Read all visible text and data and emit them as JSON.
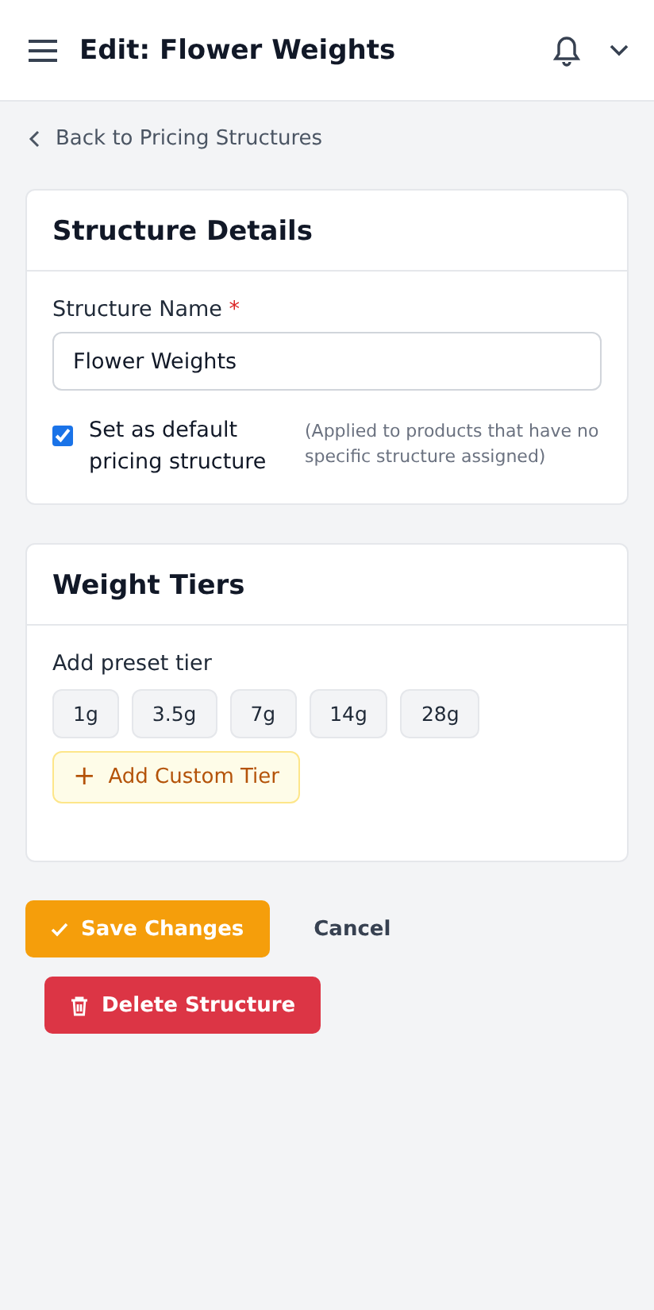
{
  "header": {
    "title": "Edit: Flower Weights"
  },
  "back_link": {
    "label": "Back to Pricing Structures"
  },
  "structure_details": {
    "title": "Structure Details",
    "name_label": "Structure Name",
    "required_mark": "*",
    "name_value": "Flower Weights",
    "default_option": {
      "label": "Set as default pricing structure",
      "note": "(Applied to products that have no specific structure assigned)",
      "checked": true
    }
  },
  "weight_tiers": {
    "title": "Weight Tiers",
    "preset_label": "Add preset tier",
    "presets": [
      "1g",
      "3.5g",
      "7g",
      "14g",
      "28g"
    ],
    "add_custom": {
      "icon": "+",
      "label": "Add Custom Tier"
    }
  },
  "actions": {
    "save": "Save Changes",
    "cancel": "Cancel",
    "delete": "Delete Structure"
  }
}
